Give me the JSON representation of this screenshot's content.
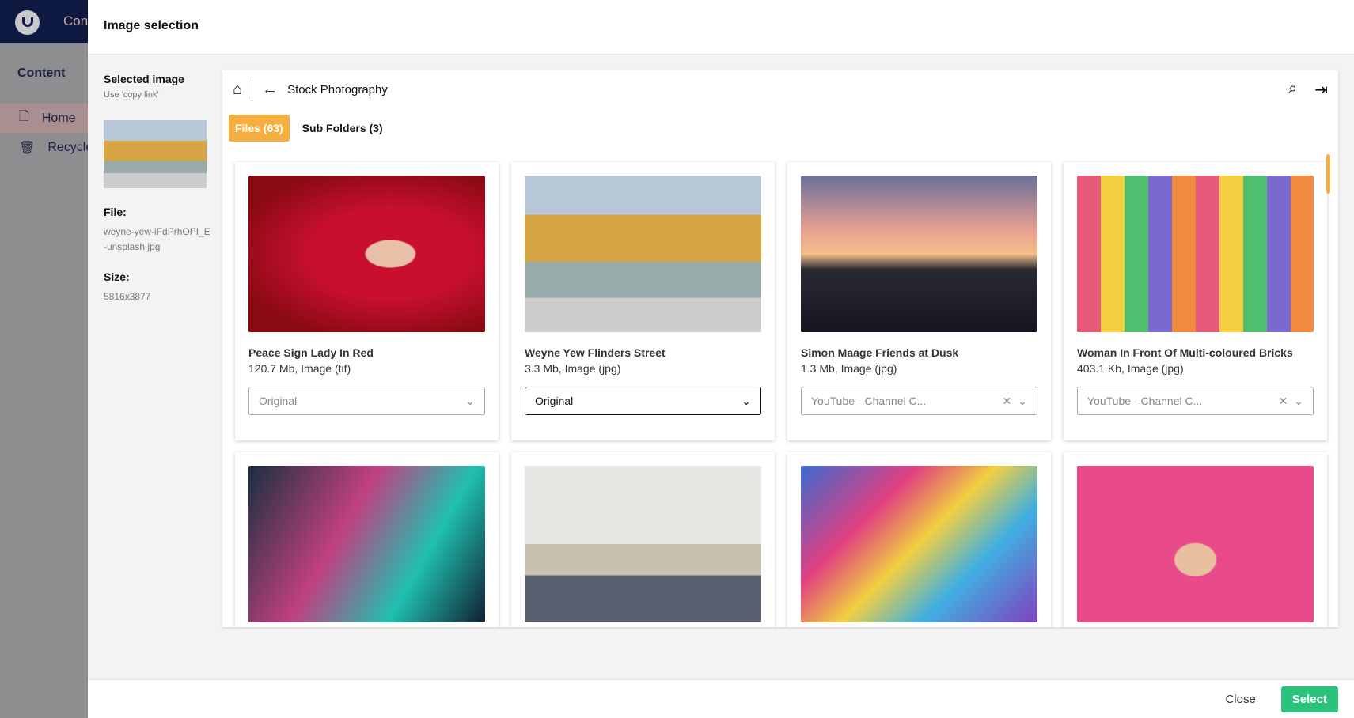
{
  "background": {
    "nav_tab": "Content",
    "section_title": "Content",
    "items": [
      {
        "label": "Home"
      },
      {
        "label": "Recycle Bin"
      }
    ]
  },
  "modal": {
    "title": "Image selection",
    "selected": {
      "heading": "Selected image",
      "hint": "Use 'copy link'",
      "file_label": "File:",
      "file_value": "weyne-yew-iFdPrhOPI_E-unsplash.jpg",
      "size_label": "Size:",
      "size_value": "5816x3877"
    },
    "breadcrumb": "Stock Photography",
    "tabs": [
      {
        "label": "Files (63)"
      },
      {
        "label": "Sub Folders (3)"
      }
    ],
    "cards": [
      {
        "name": "Peace Sign Lady In Red",
        "meta": "120.7 Mb, Image (tif)",
        "crop": "Original"
      },
      {
        "name": "Weyne Yew Flinders Street",
        "meta": "3.3 Mb, Image (jpg)",
        "crop": "Original"
      },
      {
        "name": "Simon Maage Friends at Dusk",
        "meta": "1.3 Mb, Image (jpg)",
        "crop": "YouTube - Channel C..."
      },
      {
        "name": "Woman In Front Of Multi-coloured Bricks",
        "meta": "403.1 Kb, Image (jpg)",
        "crop": "YouTube - Channel C..."
      }
    ],
    "footer": {
      "close": "Close",
      "select": "Select"
    }
  },
  "colors": {
    "accent": "#f6ae3e",
    "select": "#2bc37c",
    "nav": "#0f1a42"
  }
}
